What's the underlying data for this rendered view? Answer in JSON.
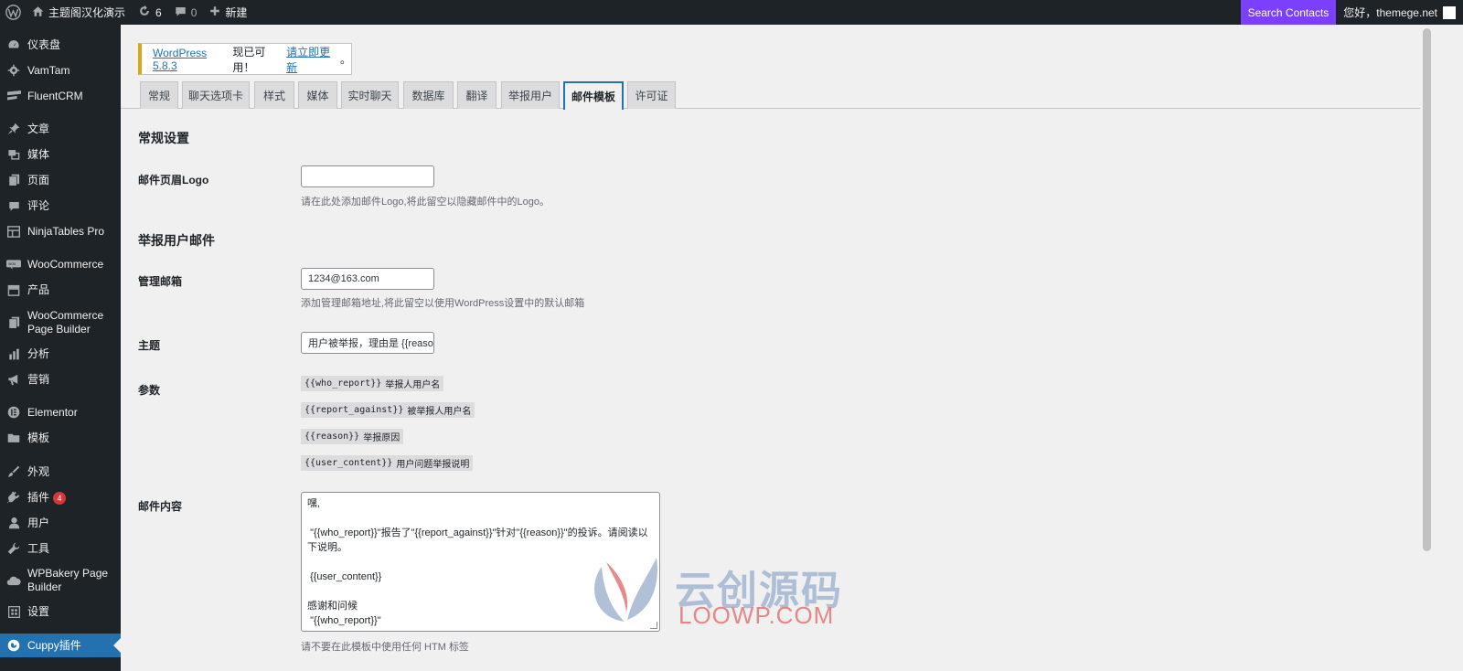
{
  "adminbar": {
    "site_name": "主题阁汉化演示",
    "updates_count": "6",
    "comments_count": "0",
    "new_label": "新建",
    "search_label": "Search Contacts",
    "howdy": "您好，themege.net"
  },
  "menu": [
    {
      "label": "仪表盘",
      "icon": "dashboard-icon"
    },
    {
      "label": "VamTam",
      "icon": "gear-icon"
    },
    {
      "label": "FluentCRM",
      "icon": "fluentcrm-icon"
    },
    {
      "label": "文章",
      "icon": "pin-icon"
    },
    {
      "label": "媒体",
      "icon": "media-icon"
    },
    {
      "label": "页面",
      "icon": "page-icon"
    },
    {
      "label": "评论",
      "icon": "comment-icon"
    },
    {
      "label": "NinjaTables Pro",
      "icon": "table-icon"
    },
    {
      "label": "WooCommerce",
      "icon": "woo-icon"
    },
    {
      "label": "产品",
      "icon": "archive-icon"
    },
    {
      "label": "WooCommerce Page Builder",
      "icon": "page-icon"
    },
    {
      "label": "分析",
      "icon": "chart-icon"
    },
    {
      "label": "营销",
      "icon": "megaphone-icon"
    },
    {
      "label": "Elementor",
      "icon": "elementor-icon"
    },
    {
      "label": "模板",
      "icon": "folder-icon"
    },
    {
      "label": "外观",
      "icon": "brush-icon"
    },
    {
      "label": "插件",
      "icon": "plugin-icon",
      "badge": "4"
    },
    {
      "label": "用户",
      "icon": "user-icon"
    },
    {
      "label": "工具",
      "icon": "wrench-icon"
    },
    {
      "label": "WPBakery Page Builder",
      "icon": "cloud-icon"
    },
    {
      "label": "设置",
      "icon": "settings-icon"
    },
    {
      "label": "Cuppy插件",
      "icon": "cuppy-icon",
      "current": true
    }
  ],
  "notice": {
    "version_link": "WordPress 5.8.3",
    "text": "现已可用！",
    "update_link": "请立即更新",
    "end": "。"
  },
  "tabs": [
    "常规",
    "聊天选项卡",
    "样式",
    "媒体",
    "实时聊天",
    "数据库",
    "翻译",
    "举报用户",
    "邮件模板",
    "许可证"
  ],
  "active_tab": "邮件模板",
  "general": {
    "title": "常规设置",
    "logo_label": "邮件页眉Logo",
    "logo_value": "",
    "logo_desc": "请在此处添加邮件Logo,将此留空以隐藏邮件中的Logo。"
  },
  "report": {
    "title": "举报用户邮件",
    "admin_email_label": "管理邮箱",
    "admin_email_value": "1234@163.com",
    "admin_email_desc": "添加管理邮箱地址,将此留空以使用WordPress设置中的默认邮箱",
    "subject_label": "主题",
    "subject_value": "用户被举报，理由是 {{reason}}",
    "params_label": "参数",
    "params": [
      {
        "code": "{{who_report}}",
        "desc": "举报人用户名"
      },
      {
        "code": "{{report_against}}",
        "desc": "被举报人用户名"
      },
      {
        "code": "{{reason}}",
        "desc": "举报原因"
      },
      {
        "code": "{{user_content}}",
        "desc": "用户问题举报说明"
      }
    ],
    "content_label": "邮件内容",
    "content_lines": [
      "嘿,",
      "",
      " \"{{who_report}}\"报告了\"{{report_against}}\"针对\"{{reason}}\"的投诉。请阅读以下说明。",
      "",
      " {{user_content}}",
      "",
      "感谢和问候",
      " \"{{who_report}}\""
    ],
    "content_desc": "请不要在此模板中使用任何 HTM 标签"
  },
  "watermark": {
    "cn": "云创源码",
    "en": "LOOWP.COM"
  }
}
